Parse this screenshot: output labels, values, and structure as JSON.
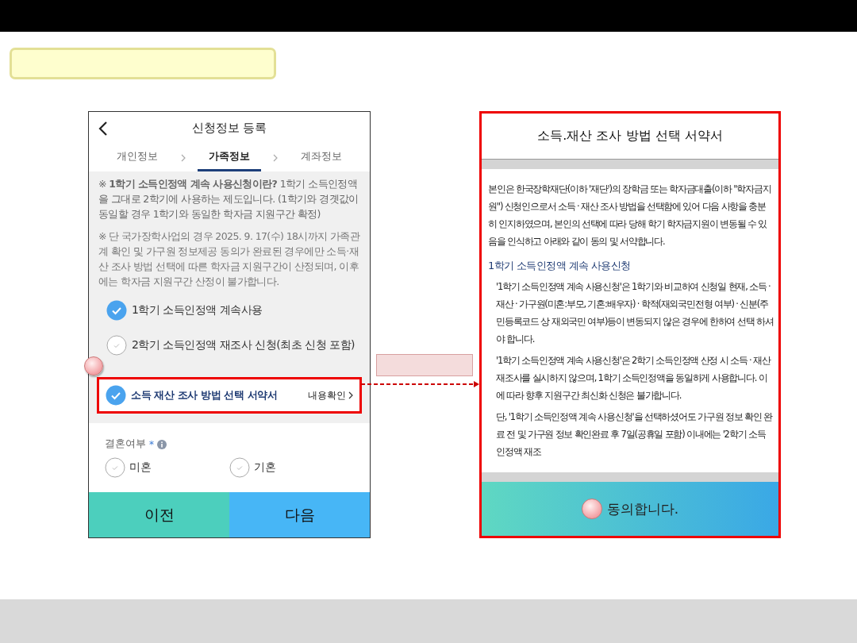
{
  "phone": {
    "title": "신청정보 등록",
    "steps": [
      {
        "label": "개인정보",
        "selected": false
      },
      {
        "label": "가족정보",
        "selected": true
      },
      {
        "label": "계좌정보",
        "selected": false
      }
    ],
    "notices": [
      {
        "kind": "highlight",
        "text": "※ **1학기 소득인정액 계속 사용신청이란?** 1학기 소득인정액을 그대로 2학기에 사용하는 제도입니다. (1학기와 경곗값이 동일할 경우 1학기와 동일한 학자금 지원구간 확정)"
      },
      {
        "kind": "plain",
        "text": "※ 단 국가장학사업의 경우 2025. 9. 17(수) 18시까지 가족관계 확인 및 가구원 정보제공 동의가 완료된 경우에만 소득·재산 조사 방법 선택에 따른 학자금 지원구간이 산정되며, 이후에는 학자금 지원구간 산정이 불가합니다."
      }
    ],
    "options": [
      {
        "label": "1학기 소득인정액 계속사용",
        "selected": true
      },
      {
        "label": "2학기 소득인정액 재조사 신청(최초 신청 포함)",
        "selected": false
      }
    ],
    "agreement": {
      "label": "소득 재산 조사 방법 선택 서약서",
      "checked": true,
      "link": "내용확인"
    },
    "marriage": {
      "label": "결혼여부",
      "required": "*",
      "options": [
        {
          "label": "미혼",
          "selected": false
        },
        {
          "label": "기혼",
          "selected": false
        }
      ]
    },
    "buttons": [
      {
        "kind": "prev",
        "label": "이전"
      },
      {
        "kind": "next",
        "label": "다음"
      }
    ]
  },
  "document": {
    "title": "소득.재산 조사 방법 선택 서약서",
    "intro": "본인은 한국장학재단(이하 '재단')의 장학금 또는 학자금대출(이하 \"학자금지원\") 신청인으로서 소득 · 재산 조사 방법을 선택함에 있어 다음 사항을 충분히 인지하였으며, 본인의 선택에 따라 당해 학기 학자금지원이 변동될 수 있음을 인식하고 아래와 같이 동의 및 서약합니다.",
    "section_title": "1학기 소득인정액 계속 사용신청",
    "paragraphs": [
      "'1학기 소득인정액 계속 사용신청'은 1학기와 비교하여 신청일 현재, 소득 · 재산 · 가구원(미혼:부모, 기혼:배우자) · 학적(재외국민전형 여부) · 신분(주민등록코드 상 재외국민 여부)등이 변동되지 않은 경우에 한하여 선택 하셔야 합니다.",
      "'1학기 소득인정액 계속 사용신청'은 2학기 소득인정액 산정 시 소득 · 재산 재조사를 실시하지 않으며, 1학기 소득인정액을 동일하게 사용합니다. 이에 따라 향후 지원구간 최신화 신청은 불가합니다.",
      "단, '1학기 소득인정액 계속 사용신청'을 선택하셨어도 가구원 정보 확인 완료 전 및 가구원 정보 확인완료 후 7일(공휴일 포함) 이내에는 '2학기 소득인정액 재조"
    ],
    "agree_button": "동의합니다."
  }
}
